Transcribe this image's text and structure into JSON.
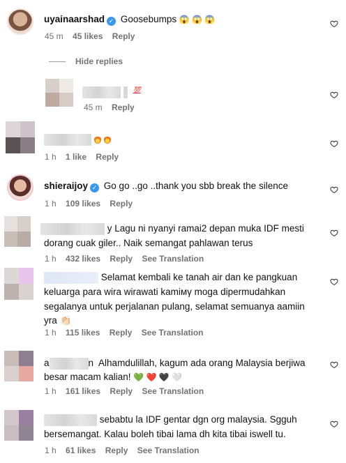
{
  "comments": [
    {
      "username": "uyainaarshad",
      "verified": true,
      "text": "Goosebumps",
      "emoji": "😱 😱 😱",
      "time": "45 m",
      "likes": "45 likes",
      "reply": "Reply"
    }
  ],
  "hide_replies": "Hide replies",
  "reply_one": {
    "badge": "💯",
    "time": "45 m",
    "reply": "Reply"
  },
  "comment_fire": {
    "time": "1 h",
    "likes": "1 like",
    "reply": "Reply"
  },
  "shieraijoy": {
    "username": "shieraijoy",
    "text": "Go go ..go ..thank you sbb break the silence",
    "time": "1 h",
    "likes": "109 likes",
    "reply": "Reply"
  },
  "comment_idf": {
    "line1": "y Lagu ni nyanyi ramai2 depan muka IDF mesti",
    "line2": "dorang cuak giler.. Naik semangat pahlawan terus",
    "time": "1 h",
    "likes": "432 likes",
    "reply": "Reply",
    "translate": "See Translation"
  },
  "comment_selamat": {
    "line1": "Selamat kembali ke tanah air dan ke pangkuan",
    "line2": "keluarga para wira wirawati kamiмγ moga dipermudahkan",
    "line3": "segalanya untuk perjalanan pulang, selamat semuanya aamiin",
    "line4": "yra 👏🏻",
    "time": "1 h",
    "likes": "115 likes",
    "reply": "Reply",
    "translate": "See Translation"
  },
  "comment_alhamdulillah": {
    "line1": "Alhamdulillah, kagum ada orang Malaysia berjiwa",
    "line2": "besar macam kalian!",
    "line2_emojis": "💚 ❤️ 🖤 🤍",
    "lead": "a",
    "tail": "n",
    "time": "1 h",
    "likes": "161 likes",
    "reply": "Reply",
    "translate": "See Translation"
  },
  "comment_sebabtu": {
    "line1": "sebabtu la IDF gentar dgn org malaysia. Sgguh",
    "line2": "bersemangat. Kalau boleh tibai lama dh kita tibai iswell tu.",
    "time": "1 h",
    "likes": "61 likes",
    "reply": "Reply",
    "translate": "See Translation"
  }
}
